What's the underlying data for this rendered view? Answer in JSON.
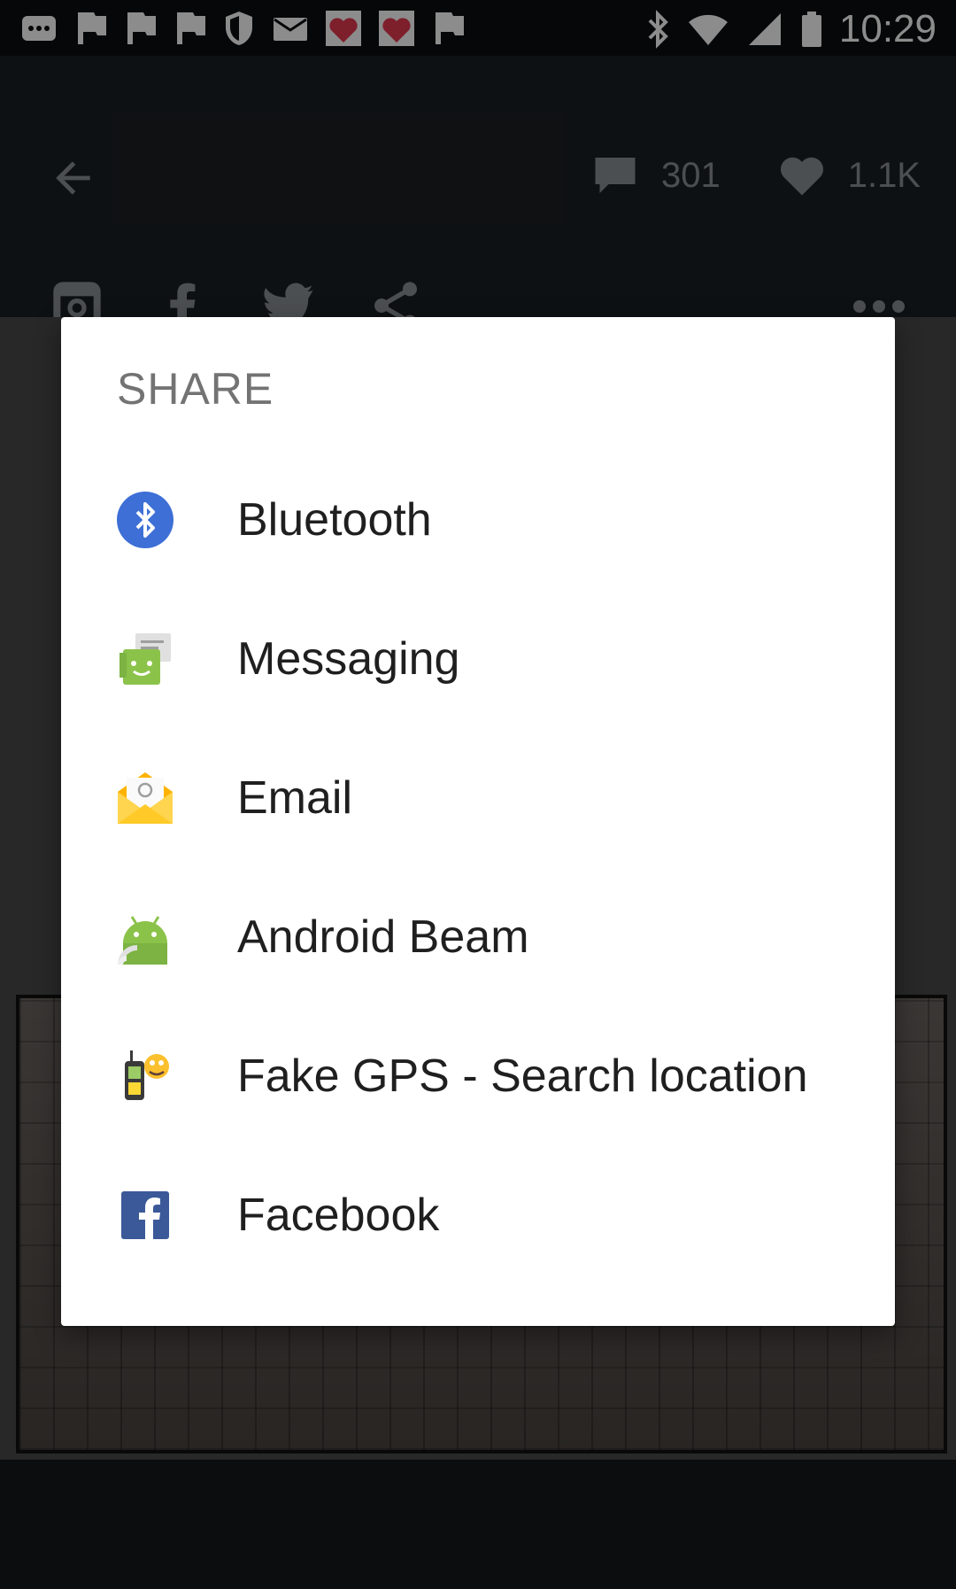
{
  "status_bar": {
    "time": "10:29",
    "left_icons": [
      "notification-icon",
      "flag-icon",
      "flag-icon",
      "flag-icon",
      "shield-icon",
      "mail-icon",
      "fast-meet-icon",
      "fast-meet-icon",
      "flag-icon"
    ],
    "right_icons": [
      "bluetooth-icon",
      "wifi-icon",
      "signal-icon",
      "battery-icon"
    ]
  },
  "app_bar": {
    "comments_count": "301",
    "likes_count": "1.1K"
  },
  "dialog": {
    "title": "SHARE",
    "items": [
      {
        "label": "Bluetooth",
        "icon": "bluetooth-icon"
      },
      {
        "label": "Messaging",
        "icon": "messaging-icon"
      },
      {
        "label": "Email",
        "icon": "email-icon"
      },
      {
        "label": "Android Beam",
        "icon": "android-beam-icon"
      },
      {
        "label": "Fake GPS - Search location",
        "icon": "fake-gps-icon"
      },
      {
        "label": "Facebook",
        "icon": "facebook-icon"
      }
    ]
  },
  "colors": {
    "background": "#15181b",
    "dialog": "#ffffff",
    "title": "#737373",
    "bluetooth": "#3d6fd6",
    "facebook": "#3b5998",
    "android": "#8bc34a"
  }
}
